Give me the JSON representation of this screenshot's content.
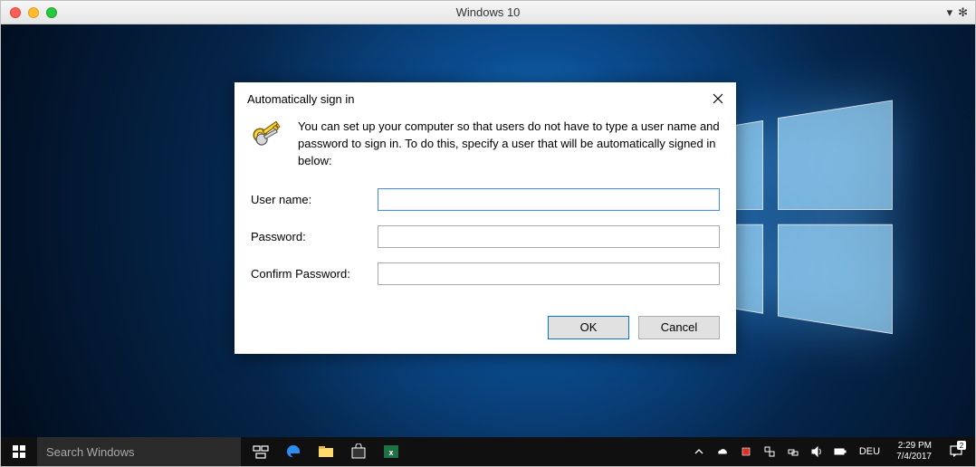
{
  "window": {
    "title": "Windows 10"
  },
  "dialog": {
    "title": "Automatically sign in",
    "description": "You can set up your computer so that users do not have to type a user name and password to sign in. To do this, specify a user that will be automatically signed in below:",
    "labels": {
      "username": "User name:",
      "password": "Password:",
      "confirm": "Confirm Password:"
    },
    "values": {
      "username": "",
      "password": "",
      "confirm": ""
    },
    "buttons": {
      "ok": "OK",
      "cancel": "Cancel"
    }
  },
  "taskbar": {
    "search_placeholder": "Search Windows",
    "language": "DEU",
    "time": "2:29 PM",
    "date": "7/4/2017",
    "notification_count": "2"
  }
}
